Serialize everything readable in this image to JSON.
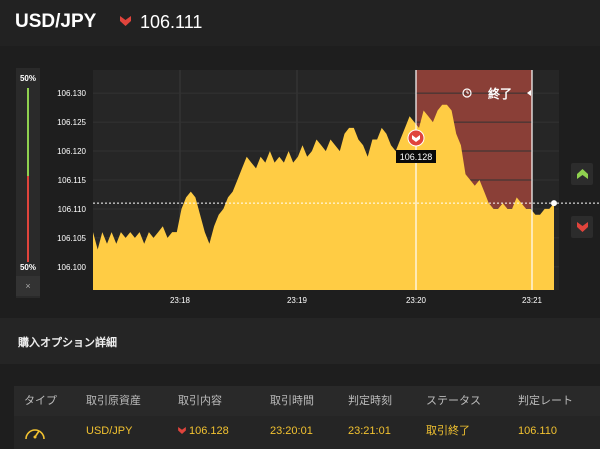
{
  "header": {
    "pair": "USD/JPY",
    "rate": "106.111",
    "rate_direction_icon": "red-down-arrow-icon"
  },
  "sentiment": {
    "top_label": "50%",
    "bottom_label": "50%",
    "close_label": "×"
  },
  "chart": {
    "end_label": "終了",
    "entry_tag": "106.128",
    "colors": {
      "area": "#ffcc44",
      "end_zone": "#8a3f37",
      "up": "#8fd14f",
      "down": "#e0443c"
    }
  },
  "chart_data": {
    "type": "area",
    "y_ticks": [
      "106.130",
      "106.125",
      "106.120",
      "106.115",
      "106.110",
      "106.105",
      "106.100"
    ],
    "x_ticks": [
      "23:18",
      "23:19",
      "23:20",
      "23:21"
    ],
    "ylim": [
      106.096,
      106.134
    ],
    "current_rate": 106.111,
    "entry_time": "23:20:01",
    "entry_rate": 106.128,
    "judgement_time": "23:21:01",
    "values": [
      106.106,
      106.103,
      106.106,
      106.104,
      106.106,
      106.104,
      106.106,
      106.105,
      106.106,
      106.105,
      106.106,
      106.104,
      106.106,
      106.105,
      106.106,
      106.107,
      106.105,
      106.106,
      106.106,
      106.11,
      106.112,
      106.113,
      106.112,
      106.109,
      106.106,
      106.104,
      106.107,
      106.109,
      106.11,
      106.112,
      106.113,
      106.115,
      106.117,
      106.119,
      106.118,
      106.117,
      106.119,
      106.118,
      106.12,
      106.118,
      106.119,
      106.118,
      106.12,
      106.118,
      106.119,
      106.121,
      106.119,
      106.12,
      106.122,
      106.121,
      106.12,
      106.122,
      106.121,
      106.12,
      106.123,
      106.124,
      106.124,
      106.122,
      106.121,
      106.119,
      106.122,
      106.122,
      106.124,
      106.123,
      106.121,
      106.12,
      106.122,
      106.124,
      106.126,
      106.125,
      106.124,
      106.127,
      106.126,
      106.125,
      106.127,
      106.128,
      106.128,
      106.127,
      106.123,
      106.121,
      106.116,
      106.115,
      106.114,
      106.115,
      106.113,
      106.111,
      106.11,
      106.11,
      106.111,
      106.11,
      106.11,
      106.112,
      106.111,
      106.11,
      106.11,
      106.109,
      106.109,
      106.11,
      106.11,
      106.111
    ]
  },
  "details": {
    "title": "購入オプション詳細",
    "columns": [
      "タイプ",
      "取引原資産",
      "取引内容",
      "取引時間",
      "判定時刻",
      "ステータス",
      "判定レート"
    ],
    "row": {
      "type_icon": "gauge-icon",
      "asset": "USD/JPY",
      "direction_icon": "red-down-arrow-icon",
      "content": "106.128",
      "trade_time": "23:20:01",
      "judgement_time": "23:21:01",
      "status": "取引終了",
      "judgement_rate": "106.110"
    }
  }
}
